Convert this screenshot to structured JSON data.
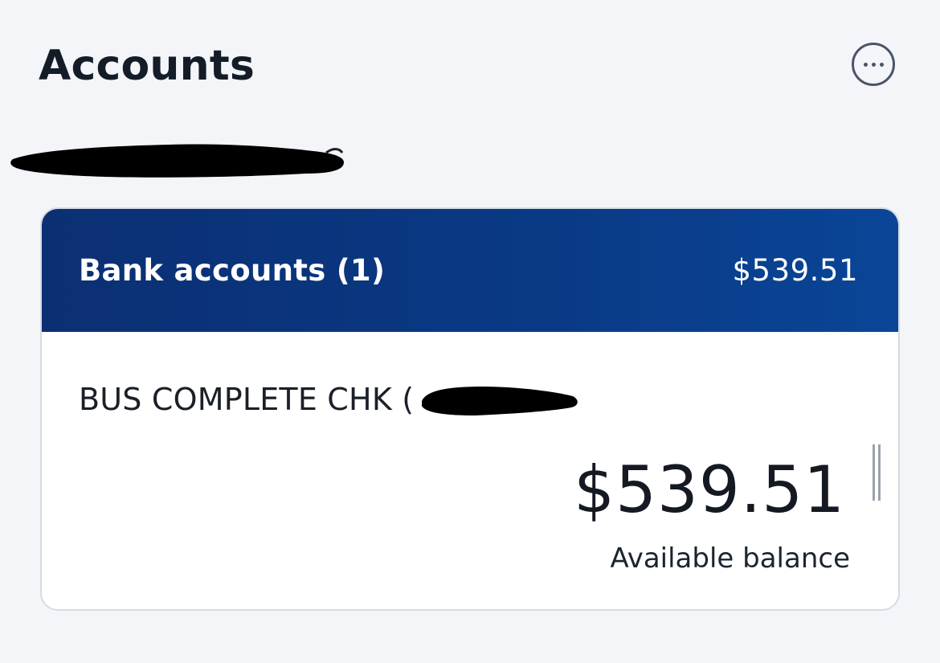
{
  "header": {
    "title": "Accounts",
    "more_icon": "more-horizontal-icon"
  },
  "account_group": {
    "label": "Bank accounts (1)",
    "total": "$539.51"
  },
  "account": {
    "name": "BUS COMPLETE CHK (",
    "balance": "$539.51",
    "balance_label": "Available balance"
  },
  "colors": {
    "header_bg": "#0a3a86",
    "page_bg": "#f3f5f9",
    "redaction": "#000000"
  }
}
